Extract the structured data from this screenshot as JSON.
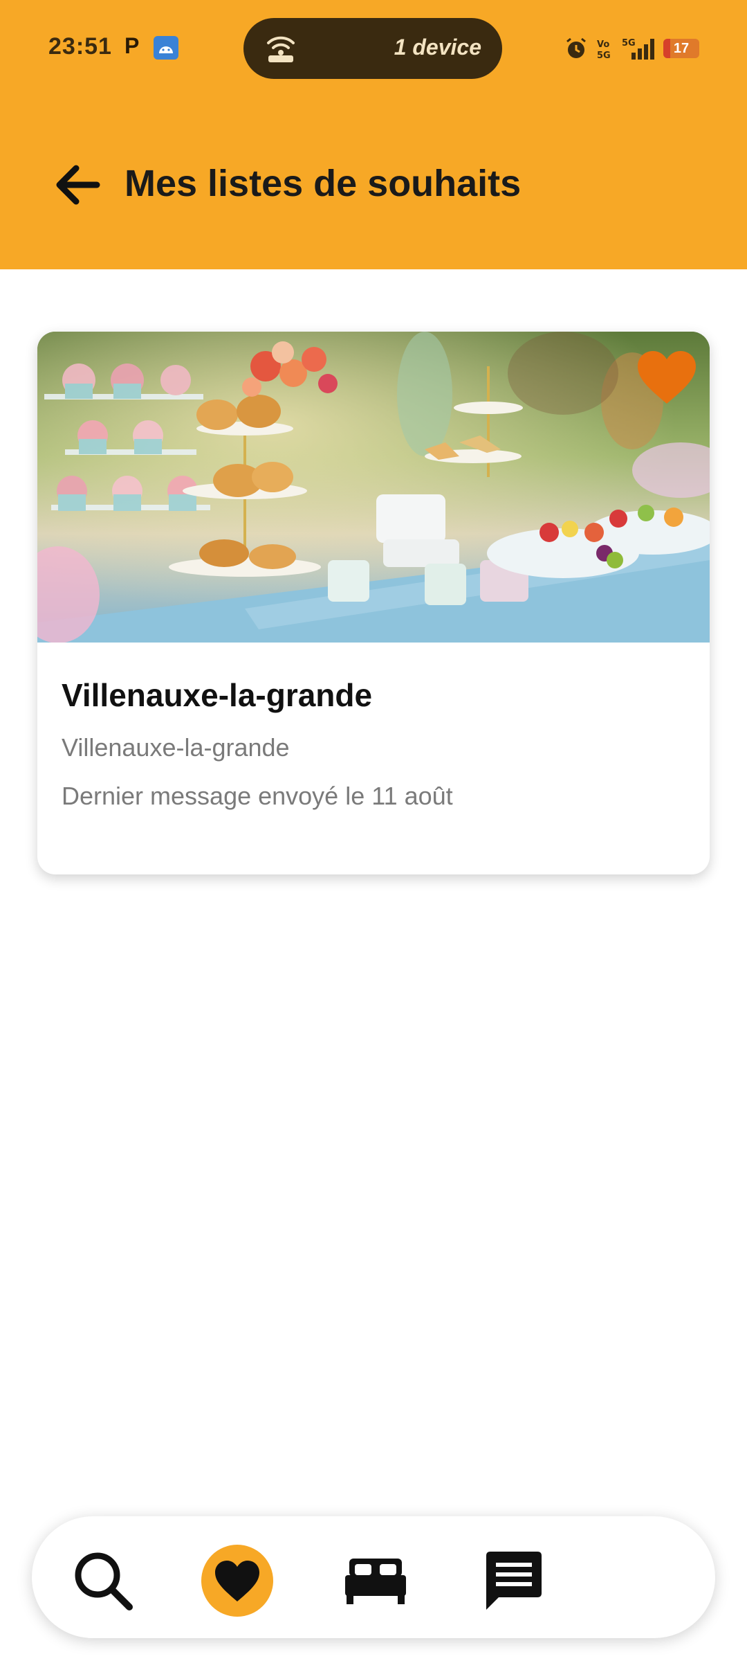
{
  "status_bar": {
    "time": "23:51",
    "hotspot_text": "1 device",
    "battery_level": "17"
  },
  "header": {
    "title": "Mes listes de souhaits"
  },
  "wishlist_card": {
    "title": "Villenauxe-la-grande",
    "subtitle": "Villenauxe-la-grande",
    "last_message": "Dernier message envoyé le 11 août"
  },
  "bottom_nav": {
    "active": "favorites",
    "items": [
      "search-icon",
      "heart-icon",
      "bed-icon",
      "message-icon"
    ]
  },
  "colors": {
    "accent": "#f7a826",
    "favorite": "#e8700e"
  }
}
